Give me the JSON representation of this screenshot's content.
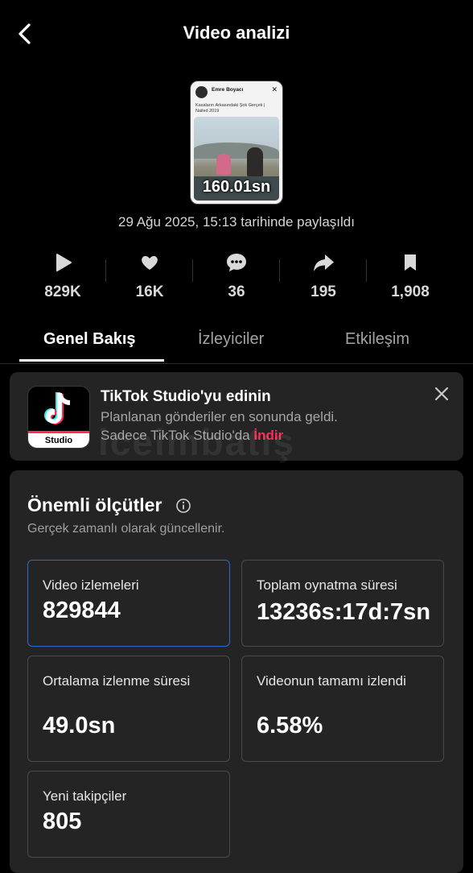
{
  "header": {
    "title": "Video analizi",
    "back_icon": "chevron-left-icon"
  },
  "video": {
    "duration": "160.01sn",
    "thumb_user": "Emre Boyacı",
    "thumb_caption": "Kasaların Arkasındaki Şok Gerçek | Nailed 2019"
  },
  "posted_text": "29 Ağu 2025, 15:13 tarihinde paylaşıldı",
  "stats": [
    {
      "icon": "play-icon",
      "value": "829K"
    },
    {
      "icon": "heart-icon",
      "value": "16K"
    },
    {
      "icon": "comment-icon",
      "value": "36"
    },
    {
      "icon": "share-icon",
      "value": "195"
    },
    {
      "icon": "bookmark-icon",
      "value": "1,908"
    }
  ],
  "tabs": [
    {
      "label": "Genel Bakış",
      "active": true
    },
    {
      "label": "İzleyiciler",
      "active": false
    },
    {
      "label": "Etkileşim",
      "active": false
    }
  ],
  "promo": {
    "title": "TikTok Studio'yu edinin",
    "line1": "Planlanan gönderiler en sonunda geldi.",
    "line2_prefix": "Sadece TikTok Studio'da ",
    "link": "İndir",
    "logo_label": "Studio",
    "accent": "#fe2c55"
  },
  "watermark": "iceimbatış",
  "metrics": {
    "title": "Önemli ölçütler",
    "subtitle": "Gerçek zamanlı olarak güncellenir.",
    "cards": [
      {
        "label": "Video izlemeleri",
        "value": "829844"
      },
      {
        "label": "Toplam oynatma süresi",
        "value": "13236s:17d:7sn"
      },
      {
        "label": "Ortalama izlenme süresi",
        "value": "49.0sn"
      },
      {
        "label": "Videonun tamamı izlendi",
        "value": "6.58%"
      },
      {
        "label": "Yeni takipçiler",
        "value": "805"
      }
    ]
  },
  "colors": {
    "background": "#000000",
    "panel": "#242424",
    "selected_border": "#2b6bd3",
    "accent": "#fe2c55"
  }
}
